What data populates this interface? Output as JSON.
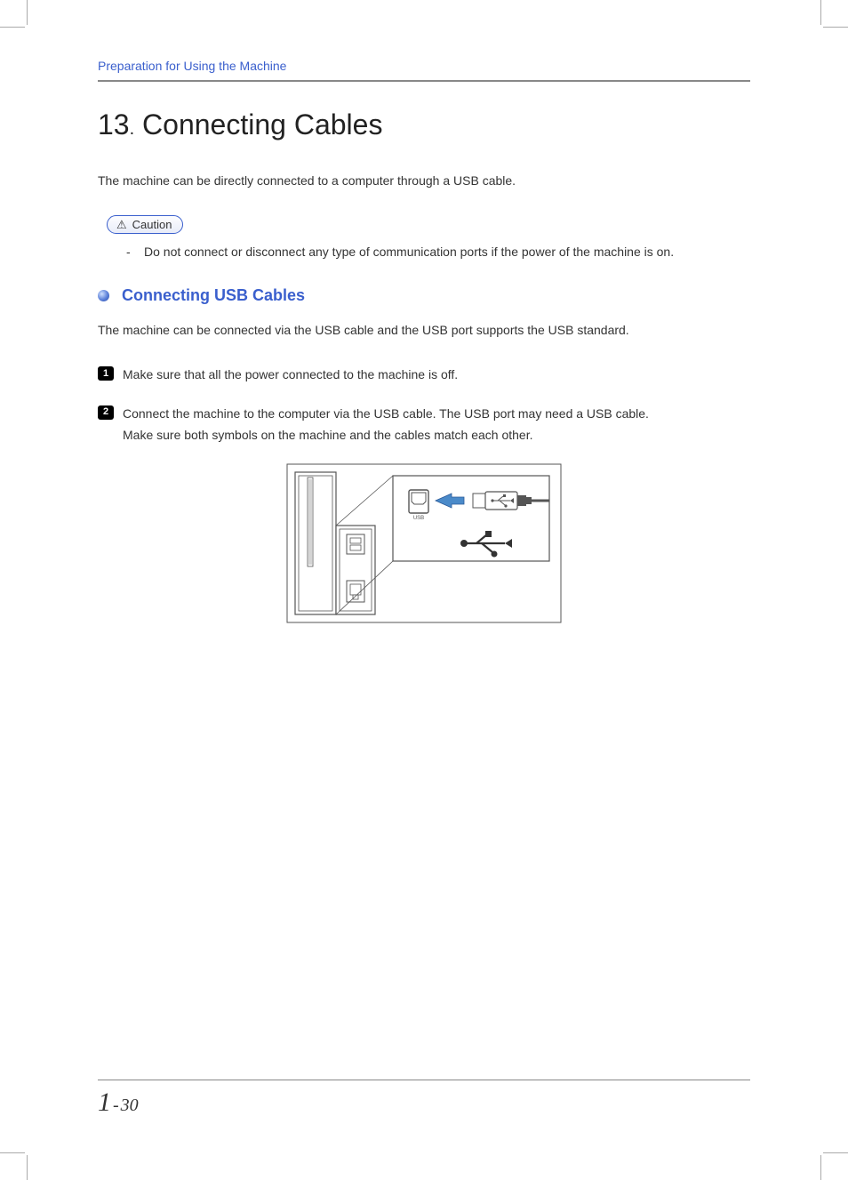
{
  "header": {
    "breadcrumb": "Preparation for Using the Machine"
  },
  "section": {
    "number": "13",
    "dot": ".",
    "title": "Connecting Cables"
  },
  "intro": "The machine can be directly connected to a computer through a USB cable.",
  "caution": {
    "label": "Caution",
    "items": [
      "Do not connect or disconnect any type of communication ports if the power of the machine is on."
    ]
  },
  "subsection": {
    "title": "Connecting USB Cables",
    "intro": "The machine can be connected via the USB cable and the USB port supports the USB standard."
  },
  "steps": [
    {
      "n": "1",
      "text": "Make sure that all the power connected to the machine is off."
    },
    {
      "n": "2",
      "text": "Connect the machine to the computer via the USB cable. The USB port may need a USB cable.",
      "text2": "Make sure both symbols on the machine and the cables match each other."
    }
  ],
  "figure": {
    "alt": "Diagram of USB port on machine back panel with arrow indicating USB cable insertion and USB symbol"
  },
  "footer": {
    "chapter": "1",
    "page": "30"
  }
}
